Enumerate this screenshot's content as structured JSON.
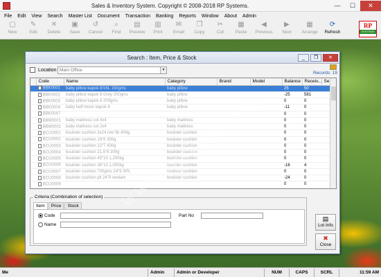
{
  "window": {
    "title": "Sales & Inventory System. Copyright © 2008-2018 RP Systems.",
    "min": "—",
    "max": "☐",
    "close": "✕"
  },
  "menu": [
    "File",
    "Edit",
    "View",
    "Search",
    "Master List",
    "Document",
    "Transaction",
    "Banking",
    "Reports",
    "Window",
    "About",
    "Admin"
  ],
  "toolbar": [
    {
      "label": "New",
      "icon": "▢",
      "enabled": false
    },
    {
      "label": "Edit",
      "icon": "✎",
      "enabled": false
    },
    {
      "label": "Delete",
      "icon": "✕",
      "enabled": false
    },
    {
      "label": "Save",
      "icon": "▣",
      "enabled": false
    },
    {
      "label": "Cancel",
      "icon": "↺",
      "enabled": false
    },
    {
      "label": "Find",
      "icon": "⌕",
      "enabled": false
    },
    {
      "label": "Preview",
      "icon": "▤",
      "enabled": false
    },
    {
      "label": "Print",
      "icon": "▥",
      "enabled": false
    },
    {
      "label": "Email",
      "icon": "✉",
      "enabled": false
    },
    {
      "label": "Copy",
      "icon": "❐",
      "enabled": false
    },
    {
      "label": "Cut",
      "icon": "✂",
      "enabled": false
    },
    {
      "label": "Paste",
      "icon": "▦",
      "enabled": false
    },
    {
      "label": "Previous",
      "icon": "◀",
      "enabled": false
    },
    {
      "label": "Next",
      "icon": "▶",
      "enabled": false
    },
    {
      "label": "Arrange",
      "icon": "▦",
      "enabled": false
    },
    {
      "label": "Refresh",
      "icon": "⟳",
      "enabled": true
    }
  ],
  "logo": {
    "main": "RP",
    "sub": "SYSTEMS"
  },
  "dialog": {
    "title": "Search : Item, Price & Stock",
    "location_label": "Location",
    "location_value": "Main Office",
    "records": "Records: 19",
    "columns": [
      "Code",
      "Name",
      "Category",
      "Brand",
      "Model",
      "Balance",
      "Receiv...",
      "Se"
    ],
    "rows": [
      {
        "code": "BBK0001",
        "name": "baby pillow kapok 8/16L 150gms",
        "category": "baby pillow",
        "balance": "25",
        "recv": "50",
        "selected": true
      },
      {
        "code": "BBK0002",
        "name": "baby pillow kapok 8 Grey 200gms",
        "category": "baby pillow",
        "balance": "-25",
        "recv": "581",
        "selected": false
      },
      {
        "code": "BBK0003",
        "name": "baby pillow kapok 6 200gms",
        "category": "baby pillow",
        "balance": "0",
        "recv": "0",
        "selected": false
      },
      {
        "code": "BBK0004",
        "name": "baby half moon kapok 8",
        "category": "baby pillow",
        "balance": "-11",
        "recv": "0",
        "selected": false
      },
      {
        "code": "BBK0047",
        "name": "",
        "category": "",
        "balance": "0",
        "recv": "0",
        "selected": false
      },
      {
        "code": "BBM0001",
        "name": "baby mattress cot 4x4",
        "category": "baby mattress",
        "balance": "0",
        "recv": "0",
        "selected": false
      },
      {
        "code": "BBM0002",
        "name": "baby mattress cot 2x4",
        "category": "baby mattress",
        "balance": "0",
        "recv": "0",
        "selected": false
      },
      {
        "code": "BCU0001",
        "name": "boulster cushion 3x24 n/w fib 400g",
        "category": "boulster cushion",
        "balance": "0",
        "recv": "0",
        "selected": false
      },
      {
        "code": "BCU0002",
        "name": "boulster cushion 18\"6 350g",
        "category": "boulster cushion",
        "balance": "0",
        "recv": "0",
        "selected": false
      },
      {
        "code": "BCU0003",
        "name": "boulster cushion 22\"7 400g",
        "category": "boulster cushion",
        "balance": "0",
        "recv": "0",
        "selected": false
      },
      {
        "code": "BCU0004",
        "name": "boulster cushion 21.5\"6 300g",
        "category": "boulster cushion",
        "balance": "0",
        "recv": "0",
        "selected": false
      },
      {
        "code": "BCU0005",
        "name": "boulster cushion 40\"10 1,200kg",
        "category": "boulster cushion",
        "balance": "0",
        "recv": "0",
        "selected": false
      },
      {
        "code": "BCU0006",
        "name": "boulster cushion 36\"10 1,000kg",
        "category": "boulster cushion",
        "balance": "-16",
        "recv": "4",
        "selected": false
      },
      {
        "code": "BCU0007",
        "name": "boulster cushion 700gms 24\"9 SPL",
        "category": "boulster cushion",
        "balance": "0",
        "recv": "0",
        "selected": false
      },
      {
        "code": "BCU0008",
        "name": "boulster cushion pil 24\"9 neelam",
        "category": "boulster cushion",
        "balance": "-24",
        "recv": "0",
        "selected": false
      },
      {
        "code": "BCU0009",
        "name": "",
        "category": "",
        "balance": "0",
        "recv": "0",
        "selected": false
      }
    ],
    "criteria": {
      "caption": "Criteria (Combination of selection)",
      "tabs": [
        "Item",
        "Price",
        "Stock"
      ],
      "code_label": "Code",
      "name_label": "Name",
      "part_label": "Part No"
    },
    "buttons": {
      "lot": "Lot Info",
      "close": "Close"
    }
  },
  "status": {
    "user": "Me",
    "role": "Admin",
    "group": "Admin or Developer",
    "num": "NUM",
    "caps": "CAPS",
    "scrl": "SCRL",
    "time": "11:59 AM"
  },
  "watermark": "www.rpsystems.lk"
}
